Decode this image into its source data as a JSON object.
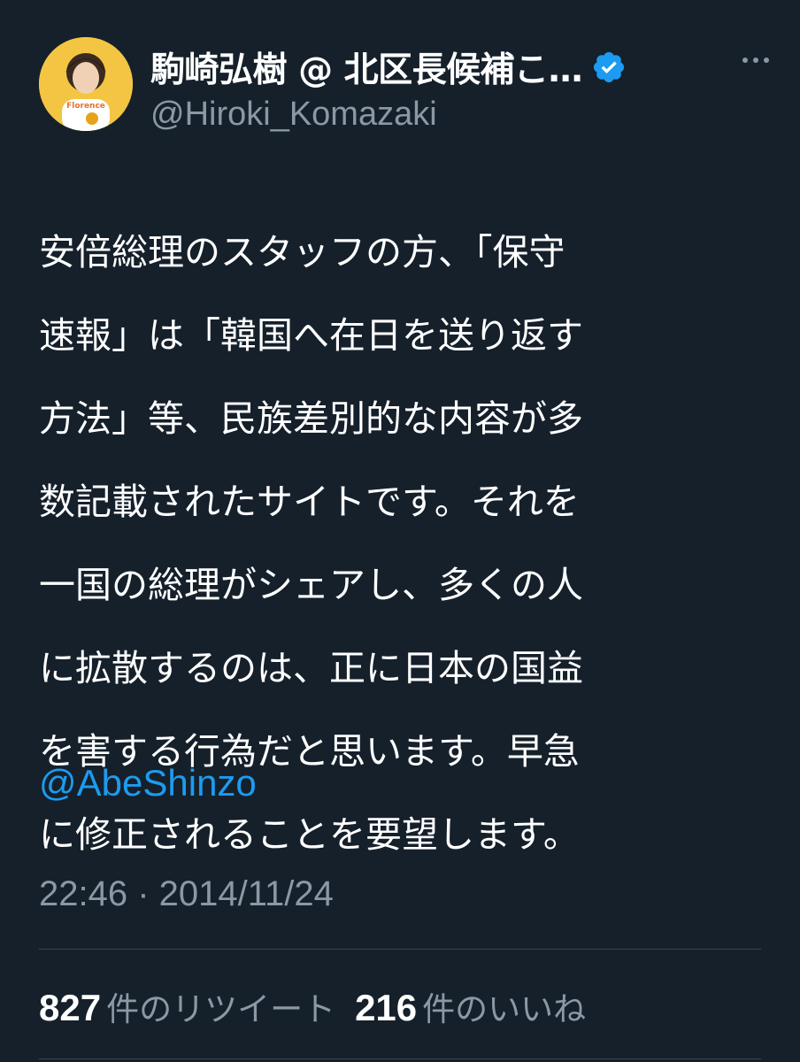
{
  "author": {
    "display_name": "駒崎弘樹 @ 北区長候補こ…",
    "handle": "@Hiroki_Komazaki",
    "verified": true,
    "avatar_icon": "avatar-photo-icon",
    "avatar_text": "Florence"
  },
  "tweet": {
    "lines": [
      "安倍総理のスタッフの方、「保守",
      "速報」は「韓国へ在日を送り返す",
      "方法」等、民族差別的な内容が多",
      "数記載されたサイトです。それを",
      "一国の総理がシェアし、多くの人",
      "に拡散するのは、正に日本の国益",
      "を害する行為だと思います。早急",
      "に修正されることを要望します。"
    ],
    "mention": "@AbeShinzo",
    "timestamp": "22:46 · 2014/11/24"
  },
  "stats": {
    "retweets_count": "827",
    "retweets_label": "件のリツイート",
    "likes_count": "216",
    "likes_label": "件のいいね"
  },
  "colors": {
    "background": "#15202b",
    "text": "#ffffff",
    "secondary": "#8b98a5",
    "accent": "#1d9bf0",
    "divider": "#38444d"
  },
  "icons": {
    "verified": "verified-badge-icon",
    "more": "more-dots-icon"
  }
}
